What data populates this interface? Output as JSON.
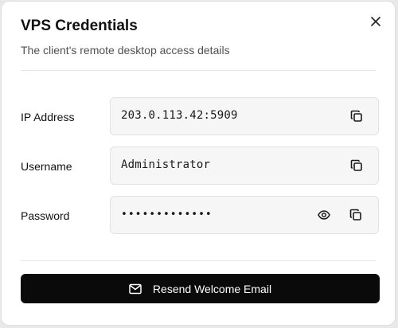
{
  "dialog": {
    "title": "VPS Credentials",
    "subtitle": "The client's remote desktop access details"
  },
  "credentials": {
    "ip": {
      "label": "IP Address",
      "value": "203.0.113.42:5909"
    },
    "username": {
      "label": "Username",
      "value": "Administrator"
    },
    "password": {
      "label": "Password",
      "masked_value": "•••••••••••••"
    }
  },
  "actions": {
    "resend_label": "Resend Welcome Email"
  },
  "icons": {
    "close": "close-icon",
    "copy": "copy-icon",
    "reveal": "eye-icon",
    "mail": "mail-icon"
  },
  "colors": {
    "primary_button": "#0a0a0a",
    "field_background": "#f6f6f6"
  }
}
